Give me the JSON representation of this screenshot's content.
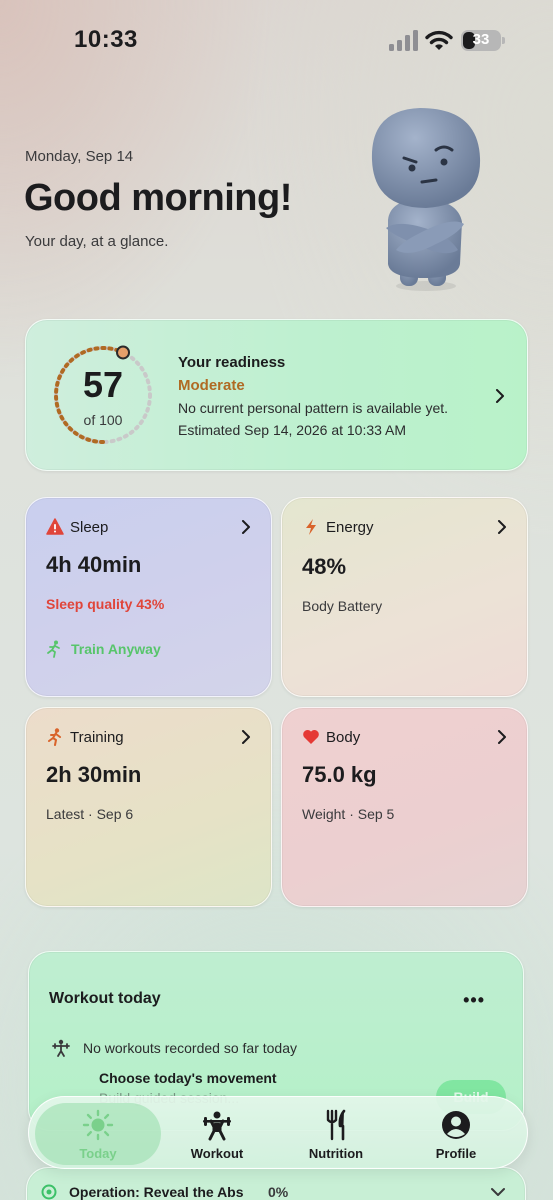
{
  "status_bar": {
    "time": "10:33",
    "battery": "33"
  },
  "header": {
    "date": "Monday, Sep 14",
    "greeting": "Good morning!",
    "subtitle": "Your day, at a glance."
  },
  "readiness": {
    "score": "57",
    "score_fraction": 0.57,
    "of_label": "of 100",
    "title": "Your readiness",
    "level": "Moderate",
    "note": "No current personal pattern is available yet.",
    "estimated": "Estimated Sep 14, 2026 at 10:33 AM",
    "accent": "#b06a23"
  },
  "tiles": {
    "sleep": {
      "label": "Sleep",
      "value": "4h 40min",
      "sub": "Sleep quality 43%",
      "action": "Train Anyway",
      "icon": "warning-icon"
    },
    "energy": {
      "label": "Energy",
      "value": "48%",
      "sub": "Body Battery",
      "icon": "lightning-icon"
    },
    "training": {
      "label": "Training",
      "value": "2h 30min",
      "sub": "Latest · Sep 6",
      "icon": "runner-icon"
    },
    "body": {
      "label": "Body",
      "value": "75.0 kg",
      "sub": "Weight · Sep 5",
      "icon": "heart-icon"
    }
  },
  "workout": {
    "title": "Workout today",
    "more": "•••",
    "none_text": "No workouts recorded so far today",
    "choose_title": "Choose today's movement",
    "choose_desc": "Build guided session...",
    "build_label": "Build"
  },
  "goal": {
    "label": "Operation: Reveal the Abs",
    "percent": "0%"
  },
  "tabs": [
    {
      "label": "Today",
      "icon": "sun-icon",
      "selected": true
    },
    {
      "label": "Workout",
      "icon": "weightlifter-icon",
      "selected": false
    },
    {
      "label": "Nutrition",
      "icon": "fork-knife-icon",
      "selected": false
    },
    {
      "label": "Profile",
      "icon": "person-icon",
      "selected": false
    }
  ]
}
